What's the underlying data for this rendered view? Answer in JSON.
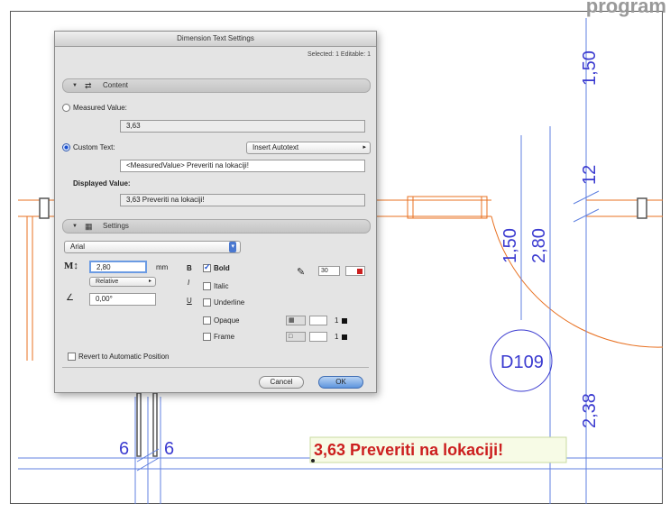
{
  "header": {
    "program_label": "program"
  },
  "drawing": {
    "dim_150_top": "1,50",
    "dim_12": "12",
    "dim_150_mid": "1,50",
    "dim_280": "2,80",
    "door_tag": "D109",
    "dim_238": "2,38",
    "dim_6_left": "6",
    "dim_6_right": "6",
    "dim_text_result": "3,63 Preveriti na lokaciji!",
    "colors": {
      "dim_blue": "#3b3bd0",
      "orange": "#e87020",
      "red": "#cc2020"
    }
  },
  "dialog": {
    "title": "Dimension Text Settings",
    "selection_info": "Selected: 1 Editable: 1",
    "content_section": {
      "label": "Content",
      "icon": "content-icon"
    },
    "measured_value": {
      "label": "Measured Value:",
      "value": "3,63"
    },
    "custom_text": {
      "label": "Custom Text:",
      "value": "<MeasuredValue> Preveriti na lokaciji!"
    },
    "insert_autotext": {
      "label": "Insert Autotext"
    },
    "displayed_value": {
      "label": "Displayed Value:",
      "value": "3,63 Preveriti na lokaciji!"
    },
    "settings_section": {
      "label": "Settings",
      "icon": "settings-icon"
    },
    "font": {
      "value": "Arial"
    },
    "size": {
      "icon_label": "M↕",
      "value": "2,80",
      "unit": "mm"
    },
    "relative": {
      "value": "Relative"
    },
    "angle": {
      "value": "0,00°"
    },
    "bold": {
      "glyph": "B",
      "label": "Bold",
      "checked": true
    },
    "italic": {
      "glyph": "I",
      "label": "Italic",
      "checked": false
    },
    "underline": {
      "glyph": "U",
      "label": "Underline",
      "checked": false
    },
    "opaque": {
      "label": "Opaque",
      "checked": false,
      "pen": "1"
    },
    "frame": {
      "label": "Frame",
      "checked": false,
      "pen": "1"
    },
    "pen_value": "30",
    "revert": {
      "label": "Revert to Automatic Position",
      "checked": false
    },
    "cancel_button": "Cancel",
    "ok_button": "OK"
  }
}
